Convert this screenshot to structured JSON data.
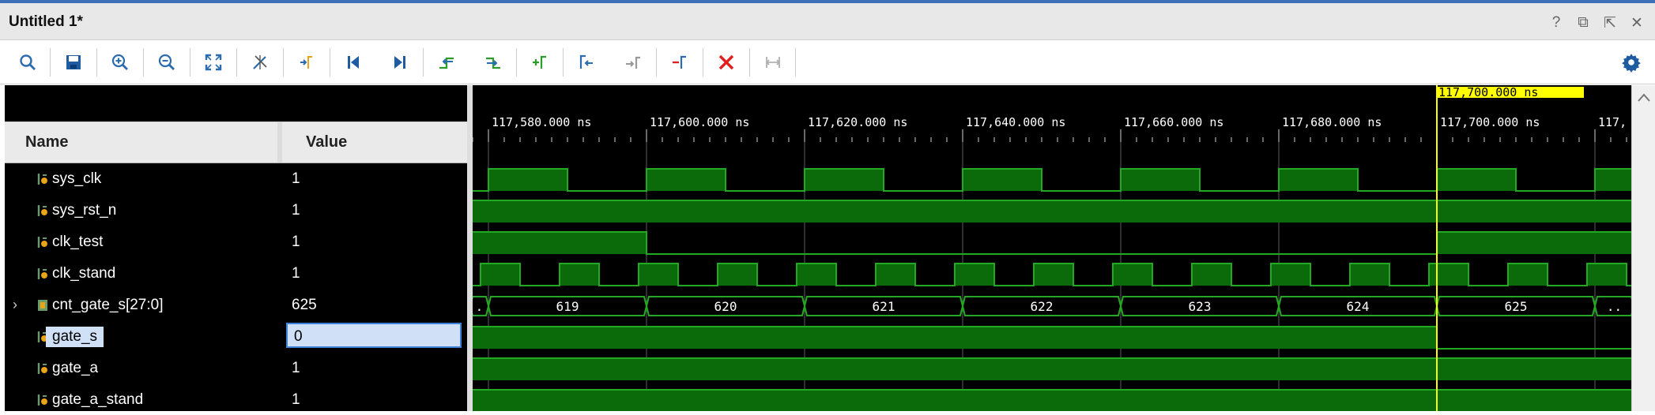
{
  "window": {
    "title": "Untitled 1*"
  },
  "window_buttons": [
    {
      "name": "help-icon",
      "glyph": "?"
    },
    {
      "name": "restore-icon",
      "glyph": "⧉"
    },
    {
      "name": "popout-icon",
      "glyph": "⇱"
    },
    {
      "name": "close-icon",
      "glyph": "✕"
    }
  ],
  "toolbar": {
    "tools": [
      {
        "name": "search-icon"
      },
      {
        "name": "save-icon"
      },
      {
        "name": "zoom-in-icon"
      },
      {
        "name": "zoom-out-icon"
      },
      {
        "name": "zoom-fit-icon"
      },
      {
        "name": "cursor-to-zoom-icon"
      },
      {
        "name": "add-marker-icon"
      },
      {
        "name": "go-to-start-icon"
      },
      {
        "name": "go-to-end-icon"
      },
      {
        "name": "previous-transition-icon"
      },
      {
        "name": "next-transition-icon"
      },
      {
        "name": "add-marker-alt-icon"
      },
      {
        "name": "previous-marker-icon"
      },
      {
        "name": "next-marker-icon"
      },
      {
        "name": "swap-cursors-icon"
      },
      {
        "name": "delete-icon"
      },
      {
        "name": "snap-icon"
      }
    ],
    "settings": "gear-icon"
  },
  "names_panel": {
    "name_header": "Name",
    "value_header": "Value"
  },
  "signals": [
    {
      "name": "sys_clk",
      "value": "1"
    },
    {
      "name": "sys_rst_n",
      "value": "1"
    },
    {
      "name": "clk_test",
      "value": "1"
    },
    {
      "name": "clk_stand",
      "value": "1"
    },
    {
      "name": "cnt_gate_s[27:0]",
      "value": "625",
      "expandable": true
    },
    {
      "name": "gate_s",
      "value": "0",
      "selected": true
    },
    {
      "name": "gate_a",
      "value": "1"
    },
    {
      "name": "gate_a_stand",
      "value": "1"
    }
  ],
  "timeline": {
    "unit": "ns",
    "ticks": [
      "117,580.000 ns",
      "117,600.000 ns",
      "117,620.000 ns",
      "117,640.000 ns",
      "117,660.000 ns",
      "117,680.000 ns",
      "117,700.000 ns",
      "117,"
    ],
    "cursor_label": "117,700.000 ns",
    "cursor_time": 117700,
    "view_start": 117578,
    "ns_per_tick": 20
  },
  "bus_values": [
    ".",
    "619",
    "620",
    "621",
    "622",
    "623",
    "624",
    "625",
    ".."
  ],
  "colors": {
    "wave": "#22a822",
    "wave_fill": "#0b6b0b",
    "cursor": "#ffff00",
    "background": "#000000",
    "delete": "#e0201e"
  }
}
